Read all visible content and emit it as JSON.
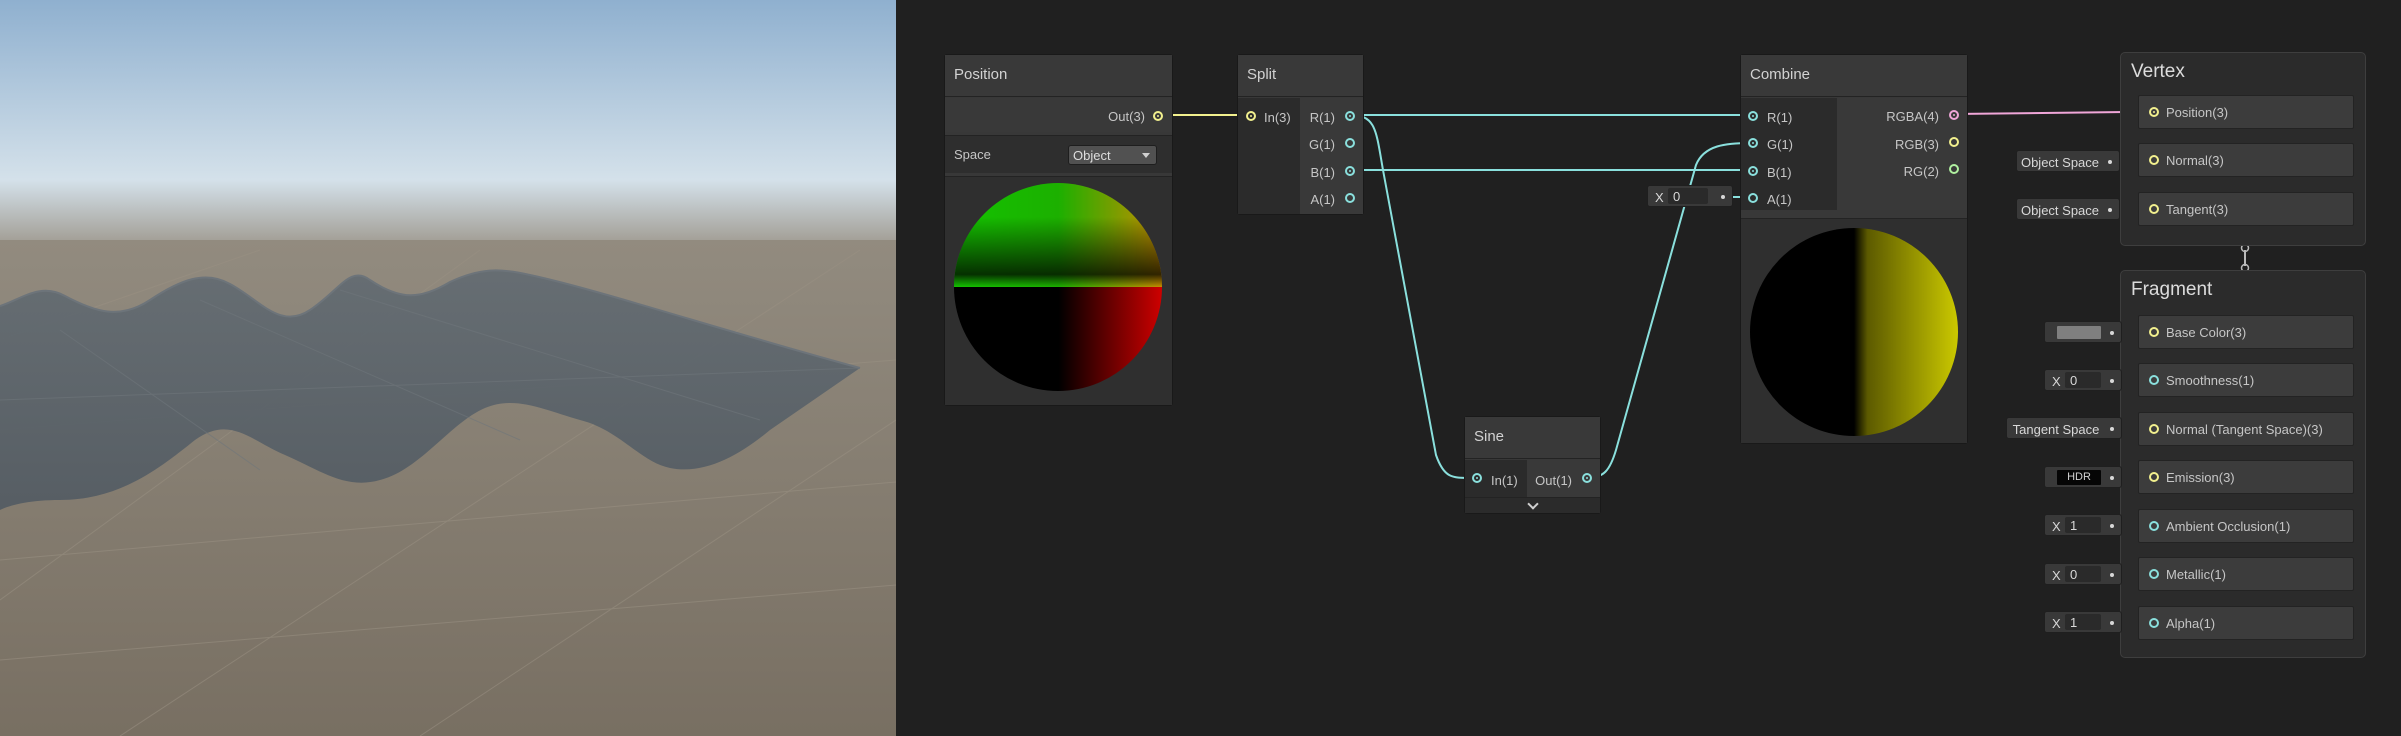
{
  "nodes": {
    "position": {
      "title": "Position",
      "output": "Out(3)",
      "space_label": "Space",
      "space_value": "Object"
    },
    "split": {
      "title": "Split",
      "input": "In(3)",
      "outputs": [
        "R(1)",
        "G(1)",
        "B(1)",
        "A(1)"
      ]
    },
    "sine": {
      "title": "Sine",
      "input": "In(1)",
      "output": "Out(1)"
    },
    "combine": {
      "title": "Combine",
      "inputs": [
        "R(1)",
        "G(1)",
        "B(1)",
        "A(1)"
      ],
      "outputs": [
        "RGBA(4)",
        "RGB(3)",
        "RG(2)"
      ],
      "a_default": {
        "x_label": "X",
        "value": "0"
      }
    }
  },
  "vertex": {
    "title": "Vertex",
    "blocks": [
      "Position(3)",
      "Normal(3)",
      "Tangent(3)"
    ],
    "normal_space": "Object Space",
    "tangent_space": "Object Space"
  },
  "fragment": {
    "title": "Fragment",
    "blocks": [
      "Base Color(3)",
      "Smoothness(1)",
      "Normal (Tangent Space)(3)",
      "Emission(3)",
      "Ambient Occlusion(1)",
      "Metallic(1)",
      "Alpha(1)"
    ],
    "smoothness": {
      "x_label": "X",
      "value": "0"
    },
    "normal_space": "Tangent Space",
    "emission_mode": "HDR",
    "ambient_occlusion": {
      "x_label": "X",
      "value": "1"
    },
    "metallic": {
      "x_label": "X",
      "value": "0"
    },
    "alpha": {
      "x_label": "X",
      "value": "1"
    }
  },
  "colors": {
    "graph_bg": "#202020",
    "node_bg": "#383838",
    "wire_float": "#8ae0dd",
    "wire_vector3": "#f2f08e",
    "wire_vector4": "#f0a6d8",
    "sky_top": "#95b6d4",
    "ground": "#7d7466",
    "waves": "#5a636a"
  },
  "icons": {
    "dropdown": "caret-down-icon",
    "expand": "chevron-down-icon"
  }
}
